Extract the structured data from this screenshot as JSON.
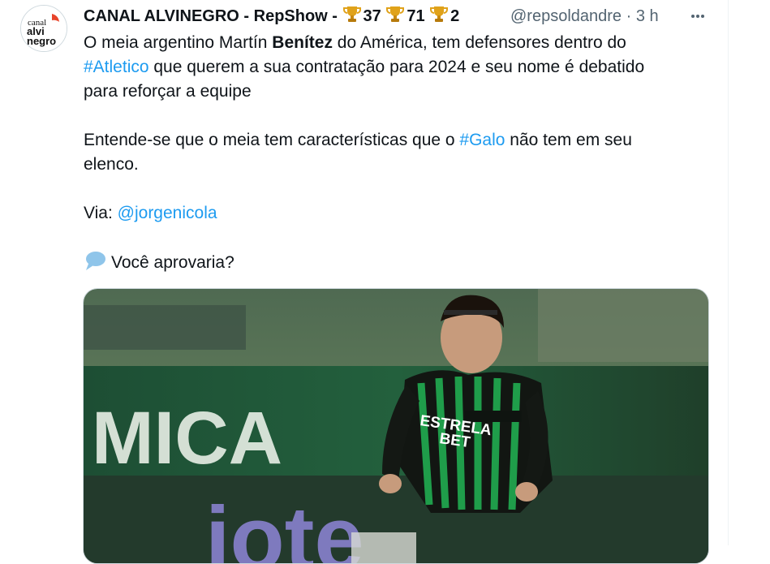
{
  "tweet": {
    "author_name": "CANAL ALVINEGRO - RepShow -",
    "trophy_counts": [
      "37",
      "71",
      "2"
    ],
    "handle": "@repsoldandre",
    "separator": "·",
    "time": "3 h",
    "lines": {
      "l1_pre": "O meia argentino Martín ",
      "l1_bold": "Benítez",
      "l1_post": " do América, tem defensores dentro do",
      "hashtag_atletico": "#Atletico",
      "l2_post": " que querem a sua contratação para 2024 e seu nome é debatido",
      "l3": "para reforçar a equipe",
      "l4_pre": "Entende-se que o meia tem características que o ",
      "hashtag_galo": "#Galo",
      "l4_post": " não tem em seu",
      "l5": "elenco.",
      "via_label": "Via: ",
      "via_mention": "@jorgenicola",
      "question": "Você aprovaria?"
    }
  },
  "avatar": {
    "line1": "canal",
    "line2": "alvi",
    "line3": "negro"
  },
  "media": {
    "board_text_1": "MICA",
    "board_text_2": "iote",
    "shirt_sponsor_1": "ESTRELA",
    "shirt_sponsor_2": "BET"
  },
  "colors": {
    "link": "#1d9bf0",
    "text": "#0f1419",
    "secondary": "#536471",
    "trophy": "#d4a017",
    "shirt_green": "#1f9d4a"
  },
  "icons": [
    "trophy-icon",
    "more-icon",
    "speech-bubble-icon"
  ]
}
